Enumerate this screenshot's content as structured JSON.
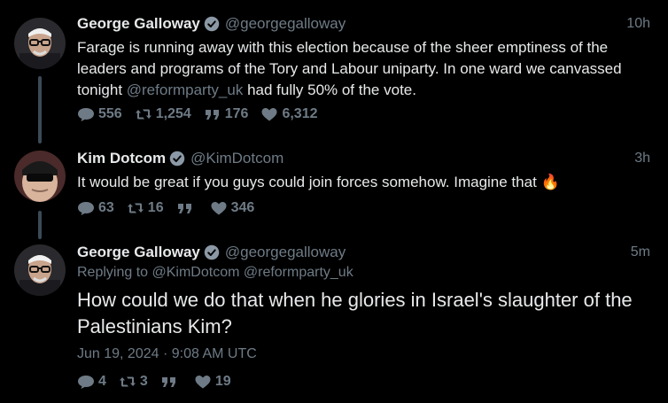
{
  "tweets": [
    {
      "name": "George Galloway",
      "handle": "@georgegalloway",
      "time": "10h",
      "text_parts": [
        "Farage is running away with this election because of the sheer emptiness of the leaders and programs of the Tory and Labour uniparty. In one ward we canvassed tonight ",
        "@reformparty_uk",
        " had fully 50% of the vote."
      ],
      "replies": "556",
      "retweets": "1,254",
      "quotes": "176",
      "likes": "6,312"
    },
    {
      "name": "Kim Dotcom",
      "handle": "@KimDotcom",
      "time": "3h",
      "text": "It would be great if you guys could join forces somehow. Imagine that",
      "emoji": "🔥",
      "replies": "63",
      "retweets": "16",
      "quotes": "",
      "likes": "346"
    },
    {
      "name": "George Galloway",
      "handle": "@georgegalloway",
      "time": "5m",
      "replying_prefix": "Replying to ",
      "replying_to": "@KimDotcom @reformparty_uk",
      "text": "How could we do that when he glories in Israel's slaughter of the Palestinians Kim?",
      "date": "Jun 19, 2024 · 9:08 AM UTC",
      "replies": "4",
      "retweets": "3",
      "quotes": "",
      "likes": "19"
    }
  ],
  "colors": {
    "background": "#000000",
    "text": "#e7e9ea",
    "muted": "#6e7b86",
    "thread_line": "#3b4a56",
    "verified": "#8b98a5"
  },
  "icons": [
    "reply-icon",
    "retweet-icon",
    "quote-icon",
    "like-icon",
    "verified-badge-icon"
  ]
}
